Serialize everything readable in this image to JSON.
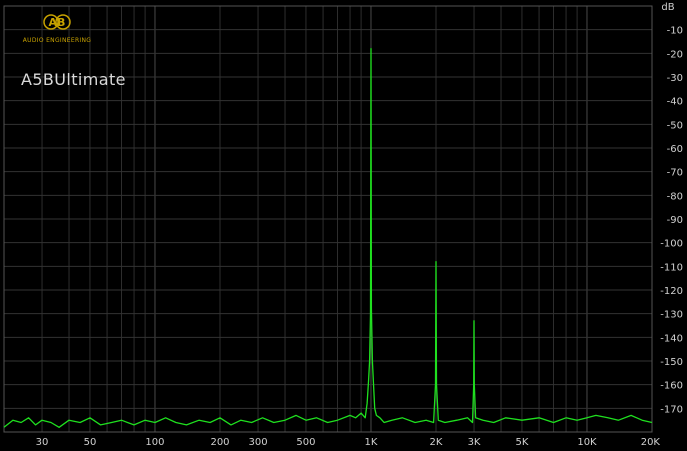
{
  "brand": {
    "logo_text": "AB",
    "tagline": "AUDIO ENGINEERING"
  },
  "product_label": "A5BUltimate",
  "colors": {
    "background": "#000000",
    "grid": "#333333",
    "trace": "#1fe01f",
    "axis_text": "#d0d0d0",
    "logo": "#c8a200"
  },
  "chart_data": {
    "type": "line",
    "title": "",
    "xlabel": "",
    "ylabel": "dB",
    "x_scale": "log",
    "xlim": [
      20,
      20000
    ],
    "ylim": [
      -180,
      0
    ],
    "grid": true,
    "x_ticks": [
      {
        "value": 30,
        "label": "30"
      },
      {
        "value": 50,
        "label": "50"
      },
      {
        "value": 100,
        "label": "100"
      },
      {
        "value": 200,
        "label": "200"
      },
      {
        "value": 300,
        "label": "300"
      },
      {
        "value": 500,
        "label": "500"
      },
      {
        "value": 1000,
        "label": "1K"
      },
      {
        "value": 2000,
        "label": "2K"
      },
      {
        "value": 3000,
        "label": "3K"
      },
      {
        "value": 5000,
        "label": "5K"
      },
      {
        "value": 10000,
        "label": "10K"
      },
      {
        "value": 20000,
        "label": "20K"
      }
    ],
    "y_ticks": [
      {
        "value": -10,
        "label": "-10"
      },
      {
        "value": -20,
        "label": "-20"
      },
      {
        "value": -30,
        "label": "-30"
      },
      {
        "value": -40,
        "label": "-40"
      },
      {
        "value": -50,
        "label": "-50"
      },
      {
        "value": -60,
        "label": "-60"
      },
      {
        "value": -70,
        "label": "-70"
      },
      {
        "value": -80,
        "label": "-80"
      },
      {
        "value": -90,
        "label": "-90"
      },
      {
        "value": -100,
        "label": "-100"
      },
      {
        "value": -110,
        "label": "-110"
      },
      {
        "value": -120,
        "label": "-120"
      },
      {
        "value": -130,
        "label": "-130"
      },
      {
        "value": -140,
        "label": "-140"
      },
      {
        "value": -150,
        "label": "-150"
      },
      {
        "value": -160,
        "label": "-160"
      },
      {
        "value": -170,
        "label": "-170"
      }
    ],
    "series": [
      {
        "x": [
          20,
          22,
          24,
          26,
          28,
          30,
          33,
          36,
          40,
          45,
          50,
          56,
          63,
          70,
          80,
          90,
          100,
          112,
          125,
          140,
          160,
          180,
          200,
          225,
          250,
          280,
          315,
          355,
          400,
          450,
          500,
          560,
          630,
          700,
          800,
          850,
          900,
          940,
          960,
          975,
          985,
          995,
          1000,
          1005,
          1015,
          1025,
          1040,
          1060,
          1100,
          1150,
          1250,
          1400,
          1600,
          1800,
          1950,
          1990,
          2000,
          2010,
          2050,
          2200,
          2500,
          2800,
          2950,
          2990,
          3000,
          3010,
          3050,
          3300,
          3700,
          4200,
          5000,
          6000,
          7000,
          8000,
          9000,
          10000,
          11000,
          12500,
          14000,
          16000,
          18000,
          20000
        ],
        "y": [
          -178,
          -175,
          -176,
          -174,
          -177,
          -175,
          -176,
          -178,
          -175,
          -176,
          -174,
          -177,
          -176,
          -175,
          -177,
          -175,
          -176,
          -174,
          -176,
          -177,
          -175,
          -176,
          -174,
          -177,
          -175,
          -176,
          -174,
          -176,
          -175,
          -173,
          -175,
          -174,
          -176,
          -175,
          -173,
          -174,
          -172,
          -174,
          -168,
          -158,
          -150,
          -130,
          -18,
          -128,
          -150,
          -158,
          -170,
          -173,
          -174,
          -176,
          -175,
          -174,
          -176,
          -175,
          -176,
          -160,
          -108,
          -160,
          -175,
          -176,
          -175,
          -174,
          -176,
          -160,
          -133,
          -160,
          -174,
          -175,
          -176,
          -174,
          -175,
          -174,
          -176,
          -174,
          -175,
          -174,
          -173,
          -174,
          -175,
          -173,
          -175,
          -176
        ]
      }
    ]
  }
}
